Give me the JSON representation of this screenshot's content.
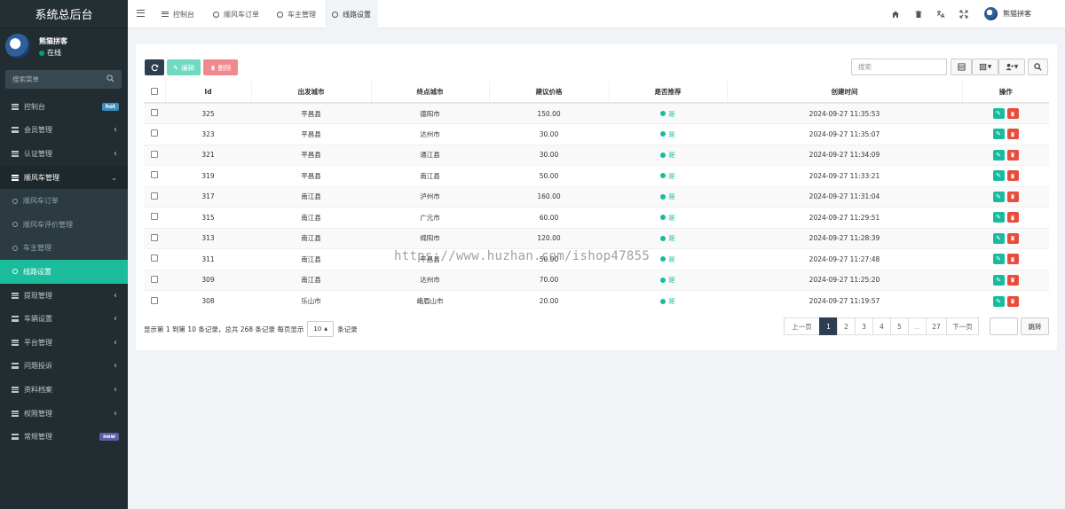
{
  "sidebar": {
    "brand": "系统总后台",
    "user_name": "熊猫拼客",
    "user_status": "在线",
    "search_placeholder": "搜索菜单",
    "items": [
      {
        "label": "控制台",
        "badge": "hot",
        "badge_color": "#3c8dbc"
      },
      {
        "label": "会员管理"
      },
      {
        "label": "认证管理"
      },
      {
        "label": "顺风车管理",
        "open": true
      },
      {
        "label": "提现管理"
      },
      {
        "label": "车辆设置"
      },
      {
        "label": "平台管理"
      },
      {
        "label": "问题投诉"
      },
      {
        "label": "资料档案"
      },
      {
        "label": "权限管理"
      },
      {
        "label": "常规管理",
        "badge": "new",
        "badge_color": "#605ca8"
      }
    ],
    "subitems": [
      {
        "label": "顺风车订单"
      },
      {
        "label": "顺风车评价管理"
      },
      {
        "label": "车主管理"
      },
      {
        "label": "线路设置",
        "active": true
      }
    ]
  },
  "topbar": {
    "tabs": [
      {
        "label": "控制台"
      },
      {
        "label": "顺风车订单"
      },
      {
        "label": "车主管理"
      },
      {
        "label": "线路设置",
        "active": true
      }
    ],
    "user_name": "熊猫拼客"
  },
  "toolbar": {
    "edit_label": "编辑",
    "delete_label": "删除",
    "search_placeholder": "搜索"
  },
  "table": {
    "columns": [
      "Id",
      "出发城市",
      "终点城市",
      "建议价格",
      "是否推荐",
      "创建时间",
      "操作"
    ],
    "rows": [
      {
        "id": "325",
        "from": "平昌县",
        "to": "德阳市",
        "price": "150.00",
        "rec": "是",
        "time": "2024-09-27 11:35:53"
      },
      {
        "id": "323",
        "from": "平昌县",
        "to": "达州市",
        "price": "30.00",
        "rec": "是",
        "time": "2024-09-27 11:35:07"
      },
      {
        "id": "321",
        "from": "平昌县",
        "to": "通江县",
        "price": "30.00",
        "rec": "是",
        "time": "2024-09-27 11:34:09"
      },
      {
        "id": "319",
        "from": "平昌县",
        "to": "南江县",
        "price": "50.00",
        "rec": "是",
        "time": "2024-09-27 11:33:21"
      },
      {
        "id": "317",
        "from": "南江县",
        "to": "泸州市",
        "price": "160.00",
        "rec": "是",
        "time": "2024-09-27 11:31:04"
      },
      {
        "id": "315",
        "from": "南江县",
        "to": "广元市",
        "price": "60.00",
        "rec": "是",
        "time": "2024-09-27 11:29:51"
      },
      {
        "id": "313",
        "from": "南江县",
        "to": "绵阳市",
        "price": "120.00",
        "rec": "是",
        "time": "2024-09-27 11:28:39"
      },
      {
        "id": "311",
        "from": "南江县",
        "to": "平昌县",
        "price": "50.00",
        "rec": "是",
        "time": "2024-09-27 11:27:48"
      },
      {
        "id": "309",
        "from": "南江县",
        "to": "达州市",
        "price": "70.00",
        "rec": "是",
        "time": "2024-09-27 11:25:20"
      },
      {
        "id": "308",
        "from": "乐山市",
        "to": "峨眉山市",
        "price": "20.00",
        "rec": "是",
        "time": "2024-09-27 11:19:57"
      }
    ]
  },
  "footer": {
    "summary": "显示第 1 到第 10 条记录，总共 268 条记录 每页显示",
    "page_size": "10",
    "suffix": "条记录"
  },
  "pagination": {
    "prev": "上一页",
    "pages": [
      "1",
      "2",
      "3",
      "4",
      "5",
      "...",
      "27"
    ],
    "next": "下一页",
    "jump": "跳转"
  },
  "watermark": "https://www.huzhan.com/ishop47855",
  "colors": {
    "sidebar_bg": "#222d32",
    "active_menu": "#1abc9c",
    "refresh_btn": "#2c3e50",
    "edit_btn": "#6fdabf",
    "delete_btn": "#f0898c",
    "recommend": "#18bc9c",
    "op_edit": "#18bc9c",
    "op_delete": "#e74c3c"
  }
}
